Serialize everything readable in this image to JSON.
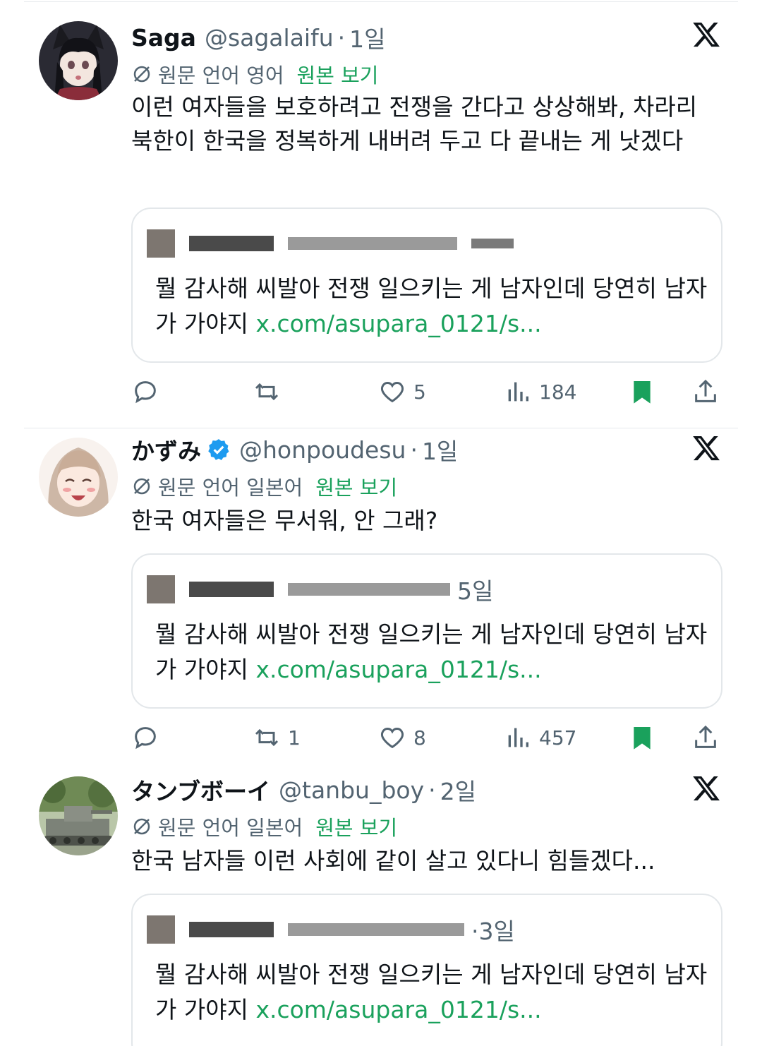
{
  "translate_label_prefix": "원문 언어",
  "show_original": "원본 보기",
  "tweets": [
    {
      "name": "Saga",
      "handle": "@sagalaifu",
      "time": "1일",
      "verified": false,
      "language": "영어",
      "text": "이런 여자들을 보호하려고 전쟁을 간다고 상상해봐, 차라리 북한이 한국을 정복하게 내버려 두고 다 끝내는 게 낫겠다",
      "quote": {
        "time": "",
        "text": "뭘 감사해 씨발아 전쟁 일으키는 게 남자인데 당연히 남자가 가야지",
        "link": "x.com/asupara_0121/s..."
      },
      "actions": {
        "replies": "",
        "reposts": "",
        "likes": "5",
        "views": "184",
        "bookmarked": true
      }
    },
    {
      "name": "かずみ",
      "handle": "@honpoudesu",
      "time": "1일",
      "verified": true,
      "language": "일본어",
      "text": "한국 여자들은 무서워, 안 그래?",
      "quote": {
        "time": "5일",
        "text": "뭘 감사해 씨발아 전쟁 일으키는 게 남자인데 당연히 남자가 가야지",
        "link": "x.com/asupara_0121/s..."
      },
      "actions": {
        "replies": "",
        "reposts": "1",
        "likes": "8",
        "views": "457",
        "bookmarked": true
      }
    },
    {
      "name": "タンブボーイ",
      "handle": "@tanbu_boy",
      "time": "2일",
      "verified": false,
      "language": "일본어",
      "text": "한국 남자들 이런 사회에 같이 살고 있다니 힘들겠다...",
      "quote": {
        "time": "3일",
        "text": "뭘 감사해 씨발아 전쟁 일으키는 게 남자인데 당연히 남자가 가야지",
        "link": "x.com/asupara_0121/s..."
      }
    }
  ],
  "colors": {
    "accent": "#1aa15c",
    "muted": "#536471",
    "text": "#0f1419",
    "verified": "#1d9bf0"
  },
  "icons": [
    "reply-icon",
    "repost-icon",
    "like-icon",
    "views-icon",
    "bookmark-icon",
    "share-icon",
    "x-logo-icon",
    "translate-icon",
    "verified-badge-icon"
  ]
}
